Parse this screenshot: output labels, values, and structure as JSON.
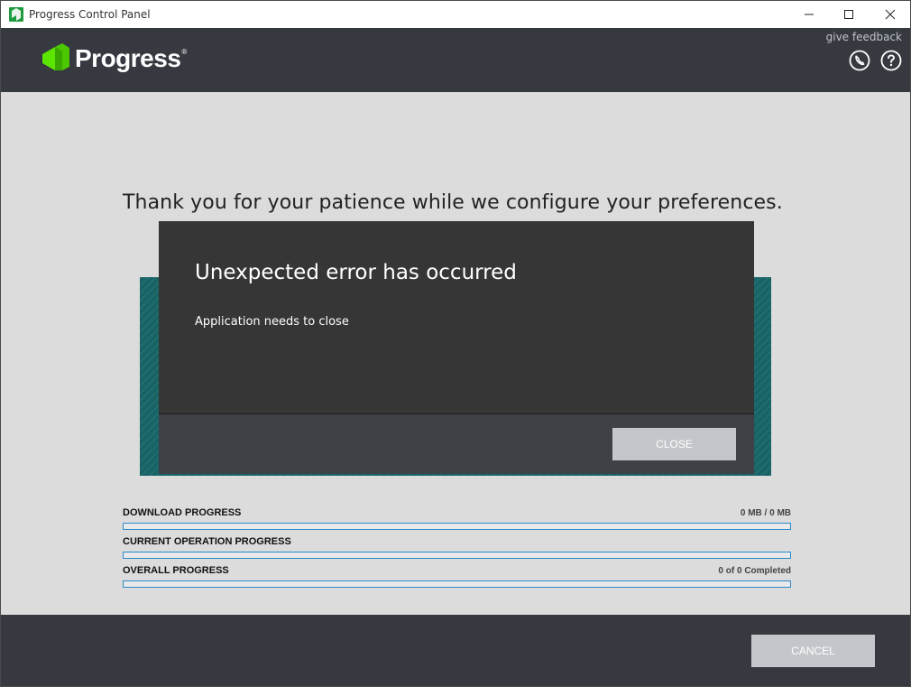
{
  "window": {
    "title": "Progress Control Panel"
  },
  "header": {
    "logo_text": "Progress",
    "logo_mark": "®",
    "feedback_link": "give feedback",
    "icons": [
      "phone-icon",
      "help-icon"
    ]
  },
  "main": {
    "headline": "Thank you for your patience while we configure your preferences."
  },
  "progress": {
    "download": {
      "label": "DOWNLOAD PROGRESS",
      "value": "0 MB / 0 MB",
      "fraction": 0
    },
    "current": {
      "label": "CURRENT OPERATION PROGRESS",
      "value": "",
      "fraction": 0
    },
    "overall": {
      "label": "OVERALL PROGRESS",
      "value": "0 of 0 Completed",
      "fraction": 0
    }
  },
  "footer": {
    "cancel_label": "CANCEL"
  },
  "dialog": {
    "title": "Unexpected error has occurred",
    "message": "Application needs to close",
    "close_label": "CLOSE"
  },
  "colors": {
    "header_bg": "#363a40",
    "brand_green": "#5ce500",
    "accent_blue": "#2a8bc9",
    "teal": "#176466",
    "dialog_bg": "#363636"
  }
}
